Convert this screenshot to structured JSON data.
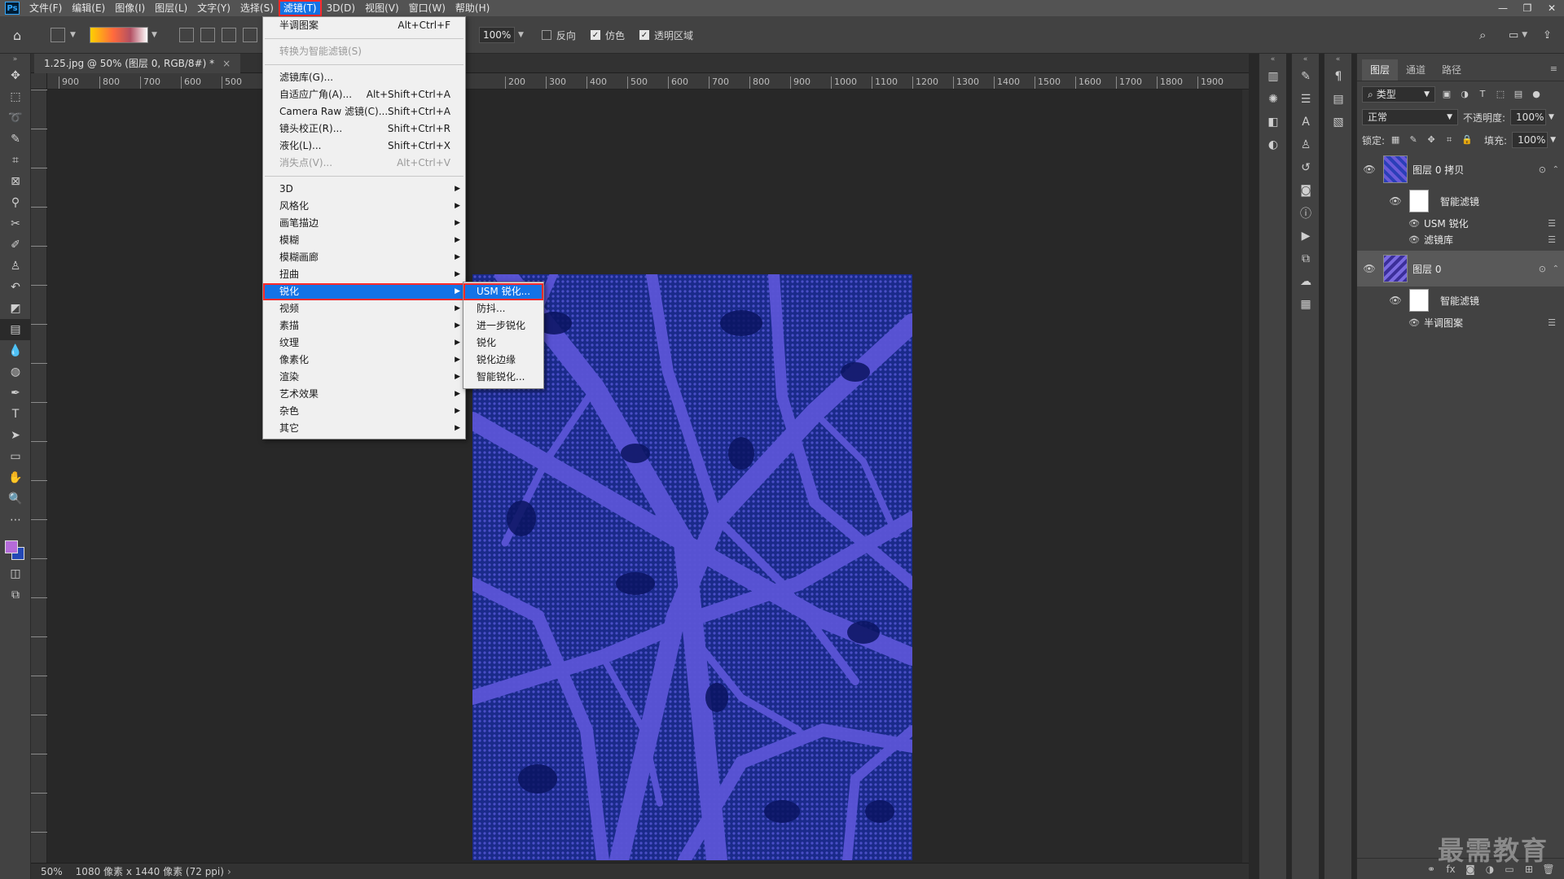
{
  "menubar": {
    "logo": "Ps",
    "items": [
      "文件(F)",
      "编辑(E)",
      "图像(I)",
      "图层(L)",
      "文字(Y)",
      "选择(S)",
      "滤镜(T)",
      "3D(D)",
      "视图(V)",
      "窗口(W)",
      "帮助(H)"
    ],
    "active_index": 6,
    "window_controls": [
      "—",
      "❐",
      "✕"
    ]
  },
  "options_bar": {
    "zoom_value": "100%",
    "checkboxes": [
      {
        "label": "反向",
        "checked": false
      },
      {
        "label": "仿色",
        "checked": true
      },
      {
        "label": "透明区域",
        "checked": true
      }
    ]
  },
  "document": {
    "tab_title": "1.25.jpg @ 50% (图层 0, RGB/8#) *",
    "tab_close": "×",
    "ruler_h_ticks": [
      "900",
      "800",
      "700",
      "600",
      "500",
      "200",
      "300",
      "400",
      "500",
      "600",
      "700",
      "800",
      "900",
      "1000",
      "1100",
      "1200",
      "1300",
      "1400",
      "1500",
      "1600",
      "1700",
      "1800",
      "1900"
    ],
    "status_zoom": "50%",
    "status_info": "1080 像素 x 1440 像素 (72 ppi)"
  },
  "filter_menu": {
    "items": [
      {
        "label": "半调图案",
        "shortcut": "Alt+Ctrl+F"
      },
      {
        "sep": true
      },
      {
        "label": "转换为智能滤镜(S)",
        "disabled": true
      },
      {
        "sep": true
      },
      {
        "label": "滤镜库(G)..."
      },
      {
        "label": "自适应广角(A)...",
        "shortcut": "Alt+Shift+Ctrl+A"
      },
      {
        "label": "Camera Raw 滤镜(C)...",
        "shortcut": "Shift+Ctrl+A"
      },
      {
        "label": "镜头校正(R)...",
        "shortcut": "Shift+Ctrl+R"
      },
      {
        "label": "液化(L)...",
        "shortcut": "Shift+Ctrl+X"
      },
      {
        "label": "消失点(V)...",
        "shortcut": "Alt+Ctrl+V",
        "disabled": true
      },
      {
        "sep": true
      },
      {
        "label": "3D",
        "submenu": true
      },
      {
        "label": "风格化",
        "submenu": true
      },
      {
        "label": "画笔描边",
        "submenu": true
      },
      {
        "label": "模糊",
        "submenu": true
      },
      {
        "label": "模糊画廊",
        "submenu": true
      },
      {
        "label": "扭曲",
        "submenu": true
      },
      {
        "label": "锐化",
        "submenu": true,
        "highlight": true
      },
      {
        "label": "视频",
        "submenu": true
      },
      {
        "label": "素描",
        "submenu": true
      },
      {
        "label": "纹理",
        "submenu": true
      },
      {
        "label": "像素化",
        "submenu": true
      },
      {
        "label": "渲染",
        "submenu": true
      },
      {
        "label": "艺术效果",
        "submenu": true
      },
      {
        "label": "杂色",
        "submenu": true
      },
      {
        "label": "其它",
        "submenu": true
      }
    ]
  },
  "sharpen_submenu": {
    "items": [
      "USM 锐化...",
      "防抖...",
      "进一步锐化",
      "锐化",
      "锐化边缘",
      "智能锐化..."
    ],
    "highlight_index": 0
  },
  "layers_panel": {
    "tabs": [
      "图层",
      "通道",
      "路径"
    ],
    "active_tab": 0,
    "filter_kind": "类型",
    "blend_mode": "正常",
    "opacity_label": "不透明度:",
    "opacity_value": "100%",
    "lock_label": "锁定:",
    "fill_label": "填充:",
    "fill_value": "100%",
    "layers": [
      {
        "name": "图层 0 拷贝",
        "smart_filter": "智能滤镜",
        "filters": [
          "USM 锐化",
          "滤镜库"
        ],
        "selected": false
      },
      {
        "name": "图层 0",
        "smart_filter": "智能滤镜",
        "filters": [
          "半调图案"
        ],
        "selected": true
      }
    ]
  },
  "watermark": "最需教育",
  "colors": {
    "foreground": "#b56bd9",
    "background": "#2448b5",
    "accent": "#1473e6",
    "highlight_border": "#ff2a2a",
    "artwork_dark": "#0e1b6b",
    "artwork_light": "#5b55d6"
  }
}
